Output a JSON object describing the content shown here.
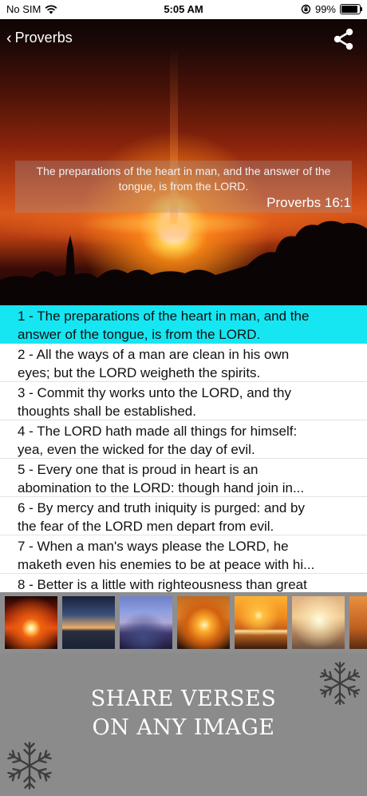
{
  "status_bar": {
    "carrier": "No SIM",
    "time": "5:05 AM",
    "battery": "99%",
    "battery_level": 0.99
  },
  "nav": {
    "back_label": "Proverbs",
    "share_icon": "share-icon"
  },
  "hero": {
    "verse_text": "The preparations of the heart in man, and the answer of the tongue, is from the LORD.",
    "verse_ref": "Proverbs 16:1"
  },
  "verses": [
    {
      "line1": "1 - The preparations of the heart in man, and the",
      "line2": "answer of the tongue, is from the LORD."
    },
    {
      "line1": "2 - All the ways of a man are clean in his own",
      "line2": "eyes; but the LORD weigheth the spirits."
    },
    {
      "line1": "3 - Commit thy works unto the LORD, and thy",
      "line2": "thoughts shall be established."
    },
    {
      "line1": "4 - The LORD hath made all things for himself:",
      "line2": "yea, even the wicked for the day of evil."
    },
    {
      "line1": "5 - Every one that is proud in heart is an",
      "line2": "abomination to the LORD: though hand join in..."
    },
    {
      "line1": "6 - By mercy and truth iniquity is purged: and by",
      "line2": "the fear of the LORD men depart from evil."
    },
    {
      "line1": "7 - When a man's ways please the LORD, he",
      "line2": "maketh even his enemies to be at peace with hi..."
    },
    {
      "line1": "8 - Better is a little with righteousness than great",
      "line2": ""
    }
  ],
  "promo": {
    "line1": "SHARE VERSES",
    "line2": "ON ANY IMAGE"
  },
  "colors": {
    "selected_row": "#16e6f2",
    "promo_bg": "#8b8b8b",
    "thumb_strip_bg": "#8e8e8e"
  }
}
